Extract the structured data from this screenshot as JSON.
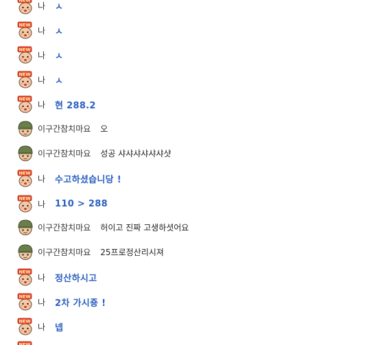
{
  "me_name": "나",
  "other_name": "이구간참치마요",
  "messages": [
    {
      "sender": "me",
      "text": "ㅅ"
    },
    {
      "sender": "me",
      "text": "ㅅ"
    },
    {
      "sender": "me",
      "text": "ㅅ"
    },
    {
      "sender": "me",
      "text": "ㅅ"
    },
    {
      "sender": "me",
      "text": "현 288.2"
    },
    {
      "sender": "other",
      "text": "오"
    },
    {
      "sender": "other",
      "text": "성공 샤샤샤샤샤샤샷"
    },
    {
      "sender": "me",
      "text": "수고하셨습니당 !"
    },
    {
      "sender": "me",
      "text": "110 > 288"
    },
    {
      "sender": "other",
      "text": "허이고 진짜 고생하셧어요"
    },
    {
      "sender": "other",
      "text": "25프로정산리시져"
    },
    {
      "sender": "me",
      "text": "정산하시고"
    },
    {
      "sender": "me",
      "text": "2차 가시죵 !"
    },
    {
      "sender": "me",
      "text": "넵"
    }
  ],
  "colors": {
    "me_text": "#2a5fbf",
    "other_text": "#222222",
    "badge_red": "#e8462c",
    "helmet_green": "#6b7d4a"
  },
  "icons": {
    "me_avatar": "new-badge-face-icon",
    "other_avatar": "soldier-helmet-face-icon"
  }
}
